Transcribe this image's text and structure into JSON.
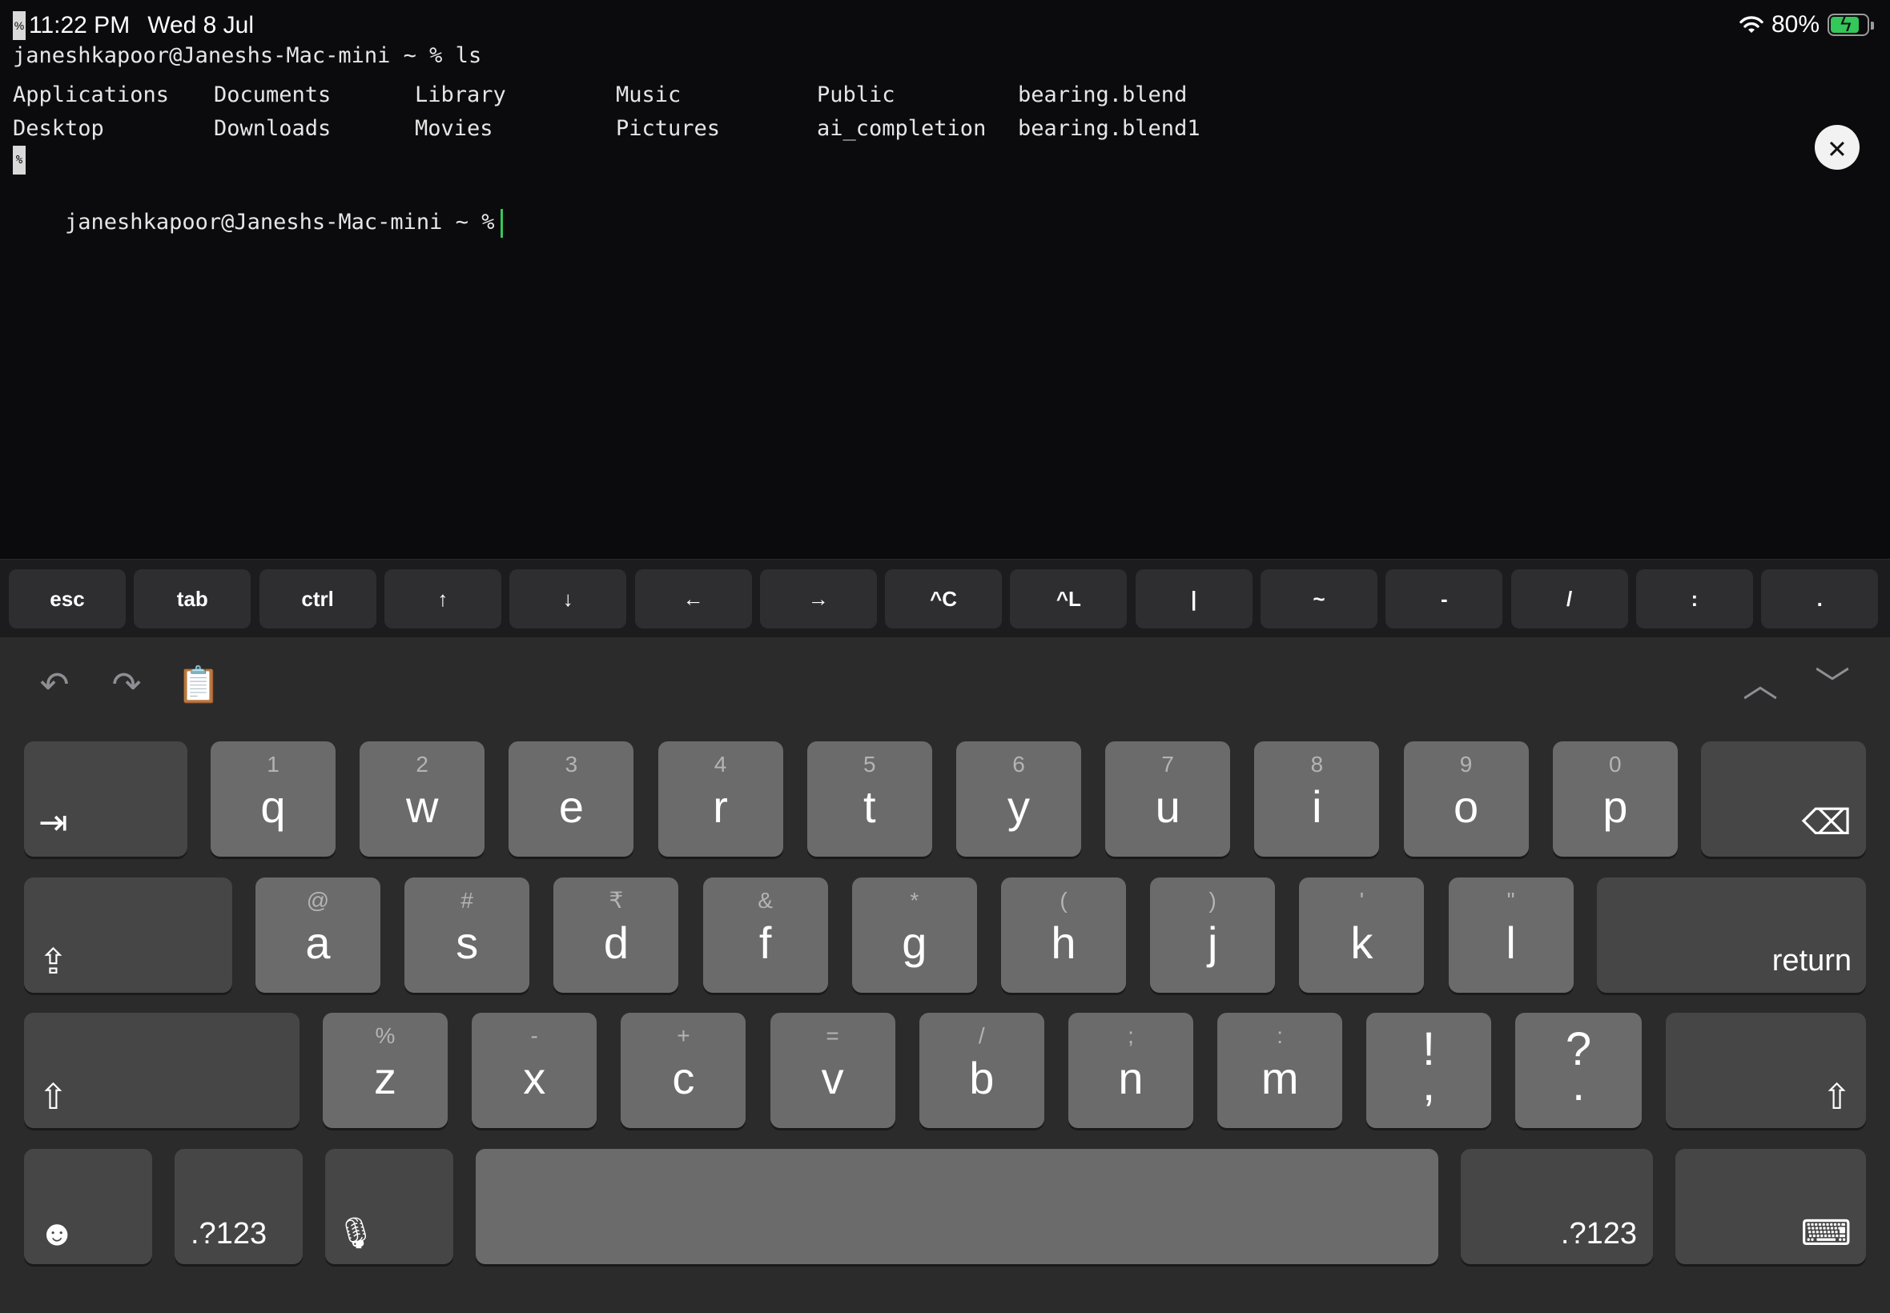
{
  "status_bar": {
    "time": "11:22 PM",
    "date": "Wed 8 Jul",
    "battery": "80%",
    "battery_level": 0.8,
    "cursor_glyph": "%"
  },
  "terminal": {
    "line1": "janeshkapoor@Janeshs-Mac-mini ~ % ls",
    "ls_output": [
      "Applications",
      "Documents",
      "Library",
      "Music",
      "Public",
      "bearing.blend",
      "Desktop",
      "Downloads",
      "Movies",
      "Pictures",
      "ai_completion",
      "bearing.blend1"
    ],
    "marker": "%",
    "prompt": "janeshkapoor@Janeshs-Mac-mini ~ %",
    "close_glyph": "✕"
  },
  "extra_keys": [
    "esc",
    "tab",
    "ctrl",
    "↑",
    "↓",
    "←",
    "→",
    "^C",
    "^L",
    "|",
    "~",
    "-",
    "/",
    ":",
    "."
  ],
  "keyboard": {
    "toolbar": {
      "undo": "↶",
      "redo": "↷",
      "paste": "📋",
      "up": "︿",
      "down": "﹀"
    },
    "row1": [
      {
        "sec": "1",
        "pri": "q"
      },
      {
        "sec": "2",
        "pri": "w"
      },
      {
        "sec": "3",
        "pri": "e"
      },
      {
        "sec": "4",
        "pri": "r"
      },
      {
        "sec": "5",
        "pri": "t"
      },
      {
        "sec": "6",
        "pri": "y"
      },
      {
        "sec": "7",
        "pri": "u"
      },
      {
        "sec": "8",
        "pri": "i"
      },
      {
        "sec": "9",
        "pri": "o"
      },
      {
        "sec": "0",
        "pri": "p"
      }
    ],
    "row2": [
      {
        "sec": "@",
        "pri": "a"
      },
      {
        "sec": "#",
        "pri": "s"
      },
      {
        "sec": "₹",
        "pri": "d"
      },
      {
        "sec": "&",
        "pri": "f"
      },
      {
        "sec": "*",
        "pri": "g"
      },
      {
        "sec": "(",
        "pri": "h"
      },
      {
        "sec": ")",
        "pri": "j"
      },
      {
        "sec": "'",
        "pri": "k"
      },
      {
        "sec": "\"",
        "pri": "l"
      }
    ],
    "row3": [
      {
        "sec": "%",
        "pri": "z"
      },
      {
        "sec": "-",
        "pri": "x"
      },
      {
        "sec": "+",
        "pri": "c"
      },
      {
        "sec": "=",
        "pri": "v"
      },
      {
        "sec": "/",
        "pri": "b"
      },
      {
        "sec": ";",
        "pri": "n"
      },
      {
        "sec": ":",
        "pri": "m"
      }
    ],
    "punct1": {
      "top": "!",
      "bottom": ","
    },
    "punct2": {
      "top": "?",
      "bottom": "."
    },
    "tab_glyph": "⇥",
    "delete_glyph": "⌫",
    "caps_glyph": "⇪",
    "shift_glyph": "⇧",
    "return_label": "return",
    "emoji_glyph": "☻",
    "numbers_label": ".?123",
    "mic_glyph": "🎙",
    "hide_keyboard_glyph": "⌨"
  }
}
